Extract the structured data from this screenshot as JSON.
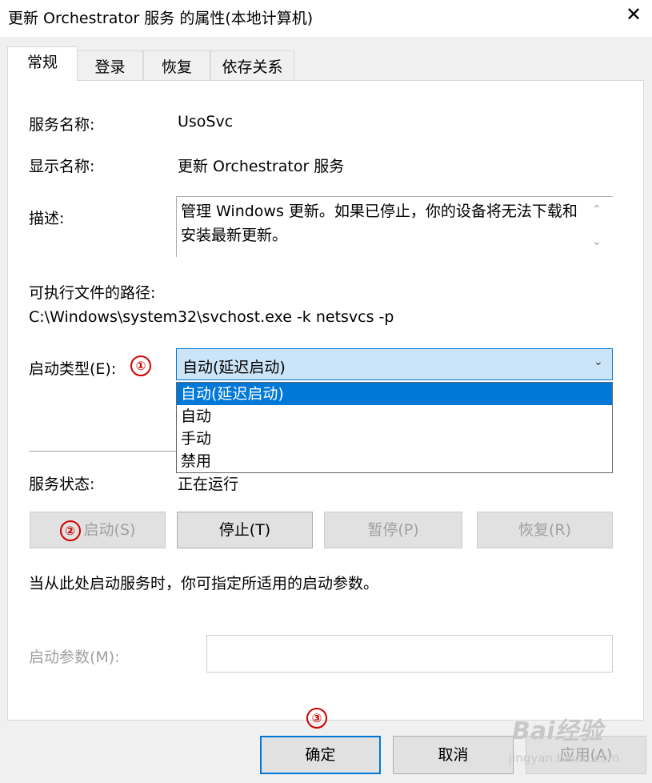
{
  "window": {
    "title": "更新 Orchestrator 服务 的属性(本地计算机)",
    "close_glyph": "✕"
  },
  "tabs": [
    {
      "label": "常规",
      "active": true
    },
    {
      "label": "登录",
      "active": false
    },
    {
      "label": "恢复",
      "active": false
    },
    {
      "label": "依存关系",
      "active": false
    }
  ],
  "general": {
    "service_name_label": "服务名称:",
    "service_name_value": "UsoSvc",
    "display_name_label": "显示名称:",
    "display_name_value": "更新 Orchestrator 服务",
    "description_label": "描述:",
    "description_value": "管理 Windows 更新。如果已停止，你的设备将无法下载和安装最新更新。",
    "exe_path_label": "可执行文件的路径:",
    "exe_path_value": "C:\\Windows\\system32\\svchost.exe -k netsvcs -p",
    "startup_type_label": "启动类型(E):",
    "startup_type_value": "自动(延迟启动)",
    "startup_type_options": [
      "自动(延迟启动)",
      "自动",
      "手动",
      "禁用"
    ],
    "service_status_label": "服务状态:",
    "service_status_value": "正在运行",
    "buttons": {
      "start": "启动(S)",
      "stop": "停止(T)",
      "pause": "暂停(P)",
      "resume": "恢复(R)"
    },
    "hint_text": "当从此处启动服务时，你可指定所适用的启动参数。",
    "start_params_label": "启动参数(M):",
    "start_params_value": ""
  },
  "annotations": {
    "step1": "①",
    "step2": "②",
    "step3": "③"
  },
  "footer": {
    "ok": "确定",
    "cancel": "取消",
    "apply": "应用(A)"
  },
  "watermark": {
    "brand": "Bai经验",
    "url": "jingyan.baidu.com"
  },
  "colors": {
    "accent": "#0078d7",
    "annotation_red": "#d00000",
    "combo_bg": "#cce4f7",
    "disabled_text": "#a0a0a0"
  }
}
